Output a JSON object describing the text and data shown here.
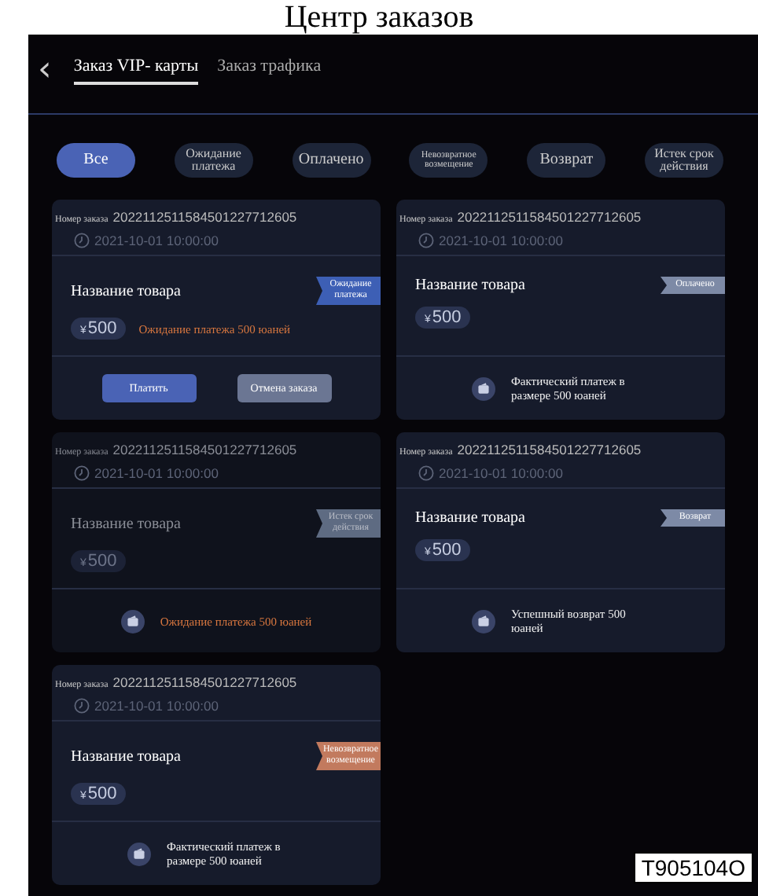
{
  "page_title": "Центр заказов",
  "back_label": "‹",
  "tabs": [
    {
      "label": "Заказ VIP- карты",
      "selected": true
    },
    {
      "label": "Заказ трафика",
      "selected": false
    }
  ],
  "filters": [
    {
      "label": "Все",
      "selected": true
    },
    {
      "label": "Ожидание платежа",
      "selected": false
    },
    {
      "label": "Оплачено",
      "selected": false
    },
    {
      "label": "Невозвратное возмещение",
      "selected": false
    },
    {
      "label": "Возврат",
      "selected": false
    },
    {
      "label": "Истек срок действия",
      "selected": false
    }
  ],
  "orders": [
    {
      "order_label": "Номер заказа",
      "order_no": "2022112511584501227712605",
      "date": "2021-10-01 10:00:00",
      "product": "Название товара",
      "price": "500",
      "currency": "¥",
      "badge": {
        "text": "Ожидание платежа",
        "color": "#3d5fb5"
      },
      "dimmed": false,
      "footer": {
        "kind": "buttons",
        "note": "Ожидание платежа 500 юаней",
        "buttons": [
          {
            "label": "Платить",
            "kind": "primary"
          },
          {
            "label": "Отмена заказа",
            "kind": "secondary"
          }
        ]
      }
    },
    {
      "order_label": "Номер заказа",
      "order_no": "2022112511584501227712605",
      "date": "2021-10-01 10:00:00",
      "product": "Название товара",
      "price": "500",
      "currency": "¥",
      "badge": {
        "text": "Оплачено",
        "color": "#7d8aa6"
      },
      "dimmed": false,
      "footer": {
        "kind": "note",
        "note": "Фактический платеж в размере 500 юаней",
        "warning": false
      }
    },
    {
      "order_label": "Номер заказа",
      "order_no": "2022112511584501227712605",
      "date": "2021-10-01 10:00:00",
      "product": "Название товара",
      "price": "500",
      "currency": "¥",
      "badge": {
        "text": "Истек срок действия",
        "color": "#5e6b82"
      },
      "dimmed": true,
      "footer": {
        "kind": "note",
        "note": "Ожидание платежа 500 юаней",
        "warning": true
      }
    },
    {
      "order_label": "Номер заказа",
      "order_no": "2022112511584501227712605",
      "date": "2021-10-01 10:00:00",
      "product": "Название товара",
      "price": "500",
      "currency": "¥",
      "badge": {
        "text": "Возврат",
        "color": "#7d8aa6"
      },
      "dimmed": false,
      "footer": {
        "kind": "note",
        "note": "Успешный возврат 500 юаней",
        "warning": false
      }
    },
    {
      "order_label": "Номер заказа",
      "order_no": "2022112511584501227712605",
      "date": "2021-10-01 10:00:00",
      "product": "Название товара",
      "price": "500",
      "currency": "¥",
      "badge": {
        "text": "Невозвратное возмещение",
        "color": "#c27a5e"
      },
      "dimmed": false,
      "footer": {
        "kind": "note",
        "note": "Фактический платеж в размере 500 юаней",
        "warning": false
      }
    }
  ],
  "figure_label": "T905104O"
}
